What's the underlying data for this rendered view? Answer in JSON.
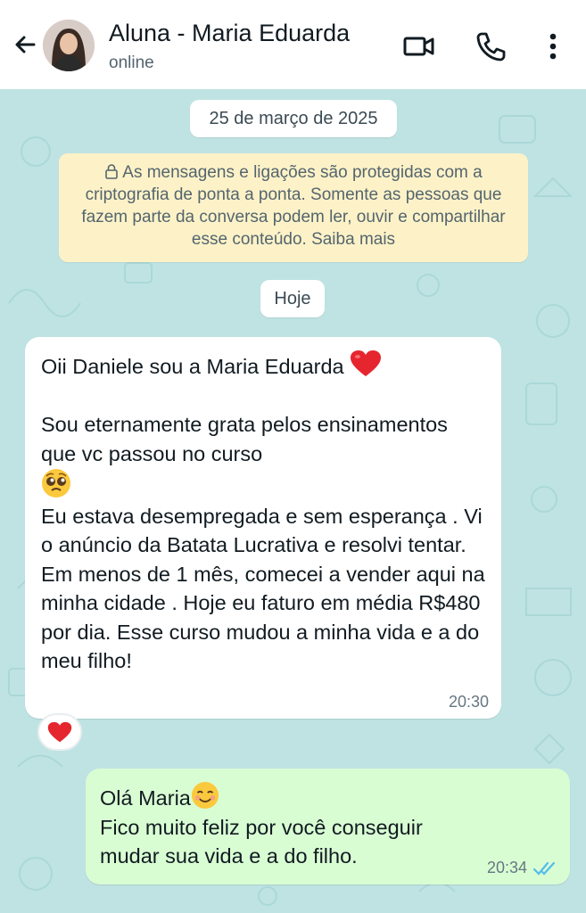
{
  "header": {
    "contact_name": "Aluna - Maria Eduarda",
    "status": "online",
    "icons": [
      "back-arrow-icon",
      "video-call-icon",
      "voice-call-icon",
      "more-options-icon"
    ]
  },
  "chat": {
    "date_label": "25 de março de 2025",
    "encryption_notice": "As mensagens e ligações são protegidas com a criptografia de ponta a ponta. Somente as pessoas que fazem parte da conversa podem ler, ouvir e compartilhar esse conteúdo. Saiba mais",
    "today_label": "Hoje",
    "messages": [
      {
        "direction": "incoming",
        "line1": "Oii Daniele sou a  Maria Eduarda",
        "line2": "Sou eternamente grata pelos ensinamentos que vc passou no curso",
        "line3": "Eu estava desempregada e sem esperança . Vi o anúncio da Batata Lucrativa e resolvi tentar. Em menos de 1 mês, comecei a vender aqui na minha cidade . Hoje eu faturo em média R$480 por dia. Esse curso mudou a minha vida e a do meu filho!",
        "time": "20:30",
        "reaction": "heart"
      },
      {
        "direction": "outgoing",
        "line1": "Olá Maria",
        "line2": "Fico muito feliz por você conseguir mudar sua vida e a do filho.",
        "time": "20:34",
        "status": "read"
      }
    ]
  },
  "colors": {
    "header_bg": "#ffffff",
    "chat_bg": "#bfe3e3",
    "incoming_bubble": "#ffffff",
    "outgoing_bubble": "#d9fdd3",
    "notice_bg": "#fdf2c7",
    "read_ticks": "#53bdeb"
  }
}
